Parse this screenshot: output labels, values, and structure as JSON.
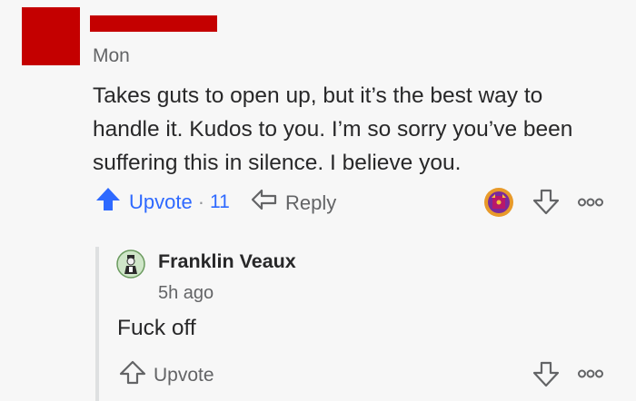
{
  "comment": {
    "time": "Mon",
    "text": "Takes guts to open up, but it’s the best way to handle it. Kudos to you. I’m so sorry you’ve been suffering this in silence. I believe you.",
    "upvote_label": "Upvote",
    "separator": "·",
    "upvote_count": "11",
    "reply_label": "Reply",
    "icons": [
      "upvote-arrow-icon",
      "reply-arrow-icon",
      "award-icon",
      "downvote-arrow-icon",
      "more-options-icon"
    ]
  },
  "reply": {
    "author": "Franklin Veaux",
    "time": "5h ago",
    "text": "Fuck off",
    "upvote_label": "Upvote",
    "icons": [
      "upvote-outline-icon",
      "downvote-arrow-icon",
      "more-options-icon"
    ]
  },
  "colors": {
    "accent": "#2e69ff",
    "redaction": "#c40000",
    "text": "#282829",
    "muted": "#636466",
    "background": "#f7f7f7"
  }
}
